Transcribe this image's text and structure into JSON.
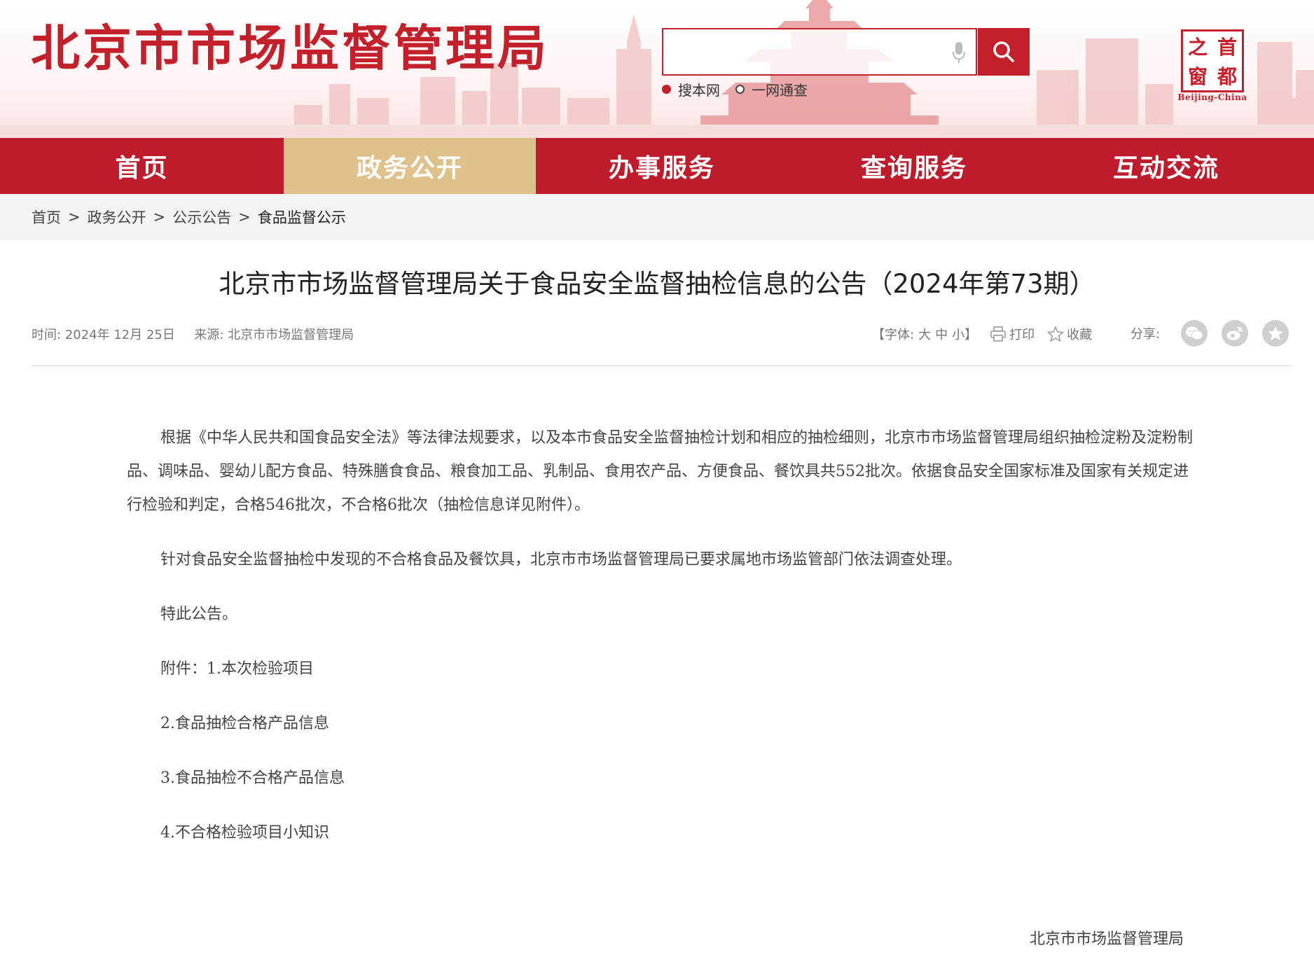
{
  "header": {
    "site_title": "北京市市场监督管理局",
    "search": {
      "placeholder": "",
      "value": "",
      "scopes": [
        {
          "label": "搜本网",
          "checked": true
        },
        {
          "label": "一网通查",
          "checked": false
        }
      ]
    },
    "logo": {
      "chars": [
        "之",
        "首",
        "窗",
        "都"
      ],
      "caption": "Beijing-China"
    }
  },
  "nav": {
    "items": [
      {
        "label": "首页",
        "active": false
      },
      {
        "label": "政务公开",
        "active": true
      },
      {
        "label": "办事服务",
        "active": false
      },
      {
        "label": "查询服务",
        "active": false
      },
      {
        "label": "互动交流",
        "active": false
      }
    ]
  },
  "breadcrumb": {
    "items": [
      "首页",
      "政务公开",
      "公示公告",
      "食品监督公示"
    ],
    "separator": ">"
  },
  "article": {
    "title": "北京市市场监督管理局关于食品安全监督抽检信息的公告（2024年第73期）",
    "meta": {
      "time_label": "时间:",
      "time_value": "2024年 12月 25日",
      "source_label": "来源:",
      "source_value": "北京市市场监督管理局"
    },
    "tools": {
      "font_prefix": "【字体:",
      "font_large": "大",
      "font_medium": "中",
      "font_small": "小",
      "font_suffix": "】",
      "print": "打印",
      "favorite": "收藏",
      "share": "分享:"
    },
    "paragraphs": [
      "根据《中华人民共和国食品安全法》等法律法规要求，以及本市食品安全监督抽检计划和相应的抽检细则，北京市市场监督管理局组织抽检淀粉及淀粉制品、调味品、婴幼儿配方食品、特殊膳食食品、粮食加工品、乳制品、食用农产品、方便食品、餐饮具共552批次。依据食品安全国家标准及国家有关规定进行检验和判定，合格546批次，不合格6批次（抽检信息详见附件）。",
      "针对食品安全监督抽检中发现的不合格食品及餐饮具，北京市市场监督管理局已要求属地市场监管部门依法调查处理。",
      "特此公告。"
    ],
    "attachments": [
      "附件：1.本次检验项目",
      "2.食品抽检合格产品信息",
      "3.食品抽检不合格产品信息",
      "4.不合格检验项目小知识"
    ],
    "signature": "北京市市场监督管理局"
  },
  "colors": {
    "brand_red": "#be1c2c",
    "nav_active": "#dfc18c"
  }
}
